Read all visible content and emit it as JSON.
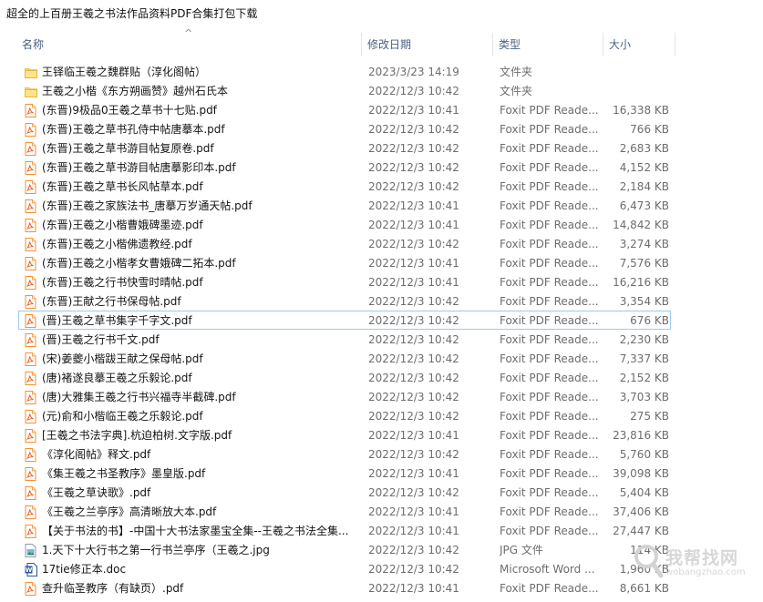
{
  "window": {
    "title": "超全的上百册王羲之书法作品资料PDF合集打包下载"
  },
  "columns": {
    "name": "名称",
    "date": "修改日期",
    "type": "类型",
    "size": "大小"
  },
  "files": [
    {
      "icon": "folder",
      "name": "王铎临王羲之魏群贴（淳化阁帖）",
      "date": "2023/3/23 14:19",
      "type": "文件夹",
      "size": ""
    },
    {
      "icon": "folder",
      "name": "王羲之小楷《东方朔画赞》越州石氏本",
      "date": "2022/12/3 10:42",
      "type": "文件夹",
      "size": ""
    },
    {
      "icon": "pdf",
      "name": "(东晋)9极品0王羲之草书十七贴.pdf",
      "date": "2022/12/3 10:41",
      "type": "Foxit PDF Reade...",
      "size": "16,338 KB"
    },
    {
      "icon": "pdf",
      "name": "(东晋)王羲之草书孔侍中帖唐摹本.pdf",
      "date": "2022/12/3 10:42",
      "type": "Foxit PDF Reade...",
      "size": "766 KB"
    },
    {
      "icon": "pdf",
      "name": "(东晋)王羲之草书游目帖复原卷.pdf",
      "date": "2022/12/3 10:42",
      "type": "Foxit PDF Reade...",
      "size": "2,683 KB"
    },
    {
      "icon": "pdf",
      "name": "(东晋)王羲之草书游目帖唐摹影印本.pdf",
      "date": "2022/12/3 10:42",
      "type": "Foxit PDF Reade...",
      "size": "4,152 KB"
    },
    {
      "icon": "pdf",
      "name": "(东晋)王羲之草书长风帖草本.pdf",
      "date": "2022/12/3 10:42",
      "type": "Foxit PDF Reade...",
      "size": "2,184 KB"
    },
    {
      "icon": "pdf",
      "name": "(东晋)王羲之家族法书_唐摹万岁通天帖.pdf",
      "date": "2022/12/3 10:41",
      "type": "Foxit PDF Reade...",
      "size": "6,473 KB"
    },
    {
      "icon": "pdf",
      "name": "(东晋)王羲之小楷曹娥碑墨迹.pdf",
      "date": "2022/12/3 10:41",
      "type": "Foxit PDF Reade...",
      "size": "14,842 KB"
    },
    {
      "icon": "pdf",
      "name": "(东晋)王羲之小楷佛遗教经.pdf",
      "date": "2022/12/3 10:42",
      "type": "Foxit PDF Reade...",
      "size": "3,274 KB"
    },
    {
      "icon": "pdf",
      "name": "(东晋)王羲之小楷孝女曹娥碑二拓本.pdf",
      "date": "2022/12/3 10:41",
      "type": "Foxit PDF Reade...",
      "size": "7,576 KB"
    },
    {
      "icon": "pdf",
      "name": "(东晋)王羲之行书快雪时晴帖.pdf",
      "date": "2022/12/3 10:41",
      "type": "Foxit PDF Reade...",
      "size": "16,216 KB"
    },
    {
      "icon": "pdf",
      "name": "(东晋)王献之行书保母帖.pdf",
      "date": "2022/12/3 10:42",
      "type": "Foxit PDF Reade...",
      "size": "3,354 KB"
    },
    {
      "icon": "pdf",
      "name": "(晋)王羲之草书集字千字文.pdf",
      "date": "2022/12/3 10:42",
      "type": "Foxit PDF Reade...",
      "size": "676 KB",
      "selected": true
    },
    {
      "icon": "pdf",
      "name": "(晋)王羲之行书千文.pdf",
      "date": "2022/12/3 10:42",
      "type": "Foxit PDF Reade...",
      "size": "2,230 KB"
    },
    {
      "icon": "pdf",
      "name": "(宋)姜夔小楷跋王献之保母帖.pdf",
      "date": "2022/12/3 10:42",
      "type": "Foxit PDF Reade...",
      "size": "7,337 KB"
    },
    {
      "icon": "pdf",
      "name": "(唐)褚遂良摹王羲之乐毅论.pdf",
      "date": "2022/12/3 10:42",
      "type": "Foxit PDF Reade...",
      "size": "2,152 KB"
    },
    {
      "icon": "pdf",
      "name": "(唐)大雅集王羲之行书兴福寺半截碑.pdf",
      "date": "2022/12/3 10:42",
      "type": "Foxit PDF Reade...",
      "size": "3,703 KB"
    },
    {
      "icon": "pdf",
      "name": "(元)俞和小楷临王羲之乐毅论.pdf",
      "date": "2022/12/3 10:42",
      "type": "Foxit PDF Reade...",
      "size": "275 KB"
    },
    {
      "icon": "pdf",
      "name": "[王羲之书法字典].杭迫柏树.文字版.pdf",
      "date": "2022/12/3 10:41",
      "type": "Foxit PDF Reade...",
      "size": "23,816 KB"
    },
    {
      "icon": "pdf",
      "name": "《淳化阁帖》释文.pdf",
      "date": "2022/12/3 10:42",
      "type": "Foxit PDF Reade...",
      "size": "5,760 KB"
    },
    {
      "icon": "pdf",
      "name": "《集王羲之书圣教序》墨皇版.pdf",
      "date": "2022/12/3 10:41",
      "type": "Foxit PDF Reade...",
      "size": "39,098 KB"
    },
    {
      "icon": "pdf",
      "name": "《王羲之草诀歌》.pdf",
      "date": "2022/12/3 10:42",
      "type": "Foxit PDF Reade...",
      "size": "5,404 KB"
    },
    {
      "icon": "pdf",
      "name": "《王羲之兰亭序》高清晰放大本.pdf",
      "date": "2022/12/3 10:41",
      "type": "Foxit PDF Reade...",
      "size": "37,406 KB"
    },
    {
      "icon": "pdf",
      "name": "【关于书法的书】-中国十大书法家墨宝全集--王羲之书法全集...",
      "date": "2022/12/3 10:41",
      "type": "Foxit PDF Reade...",
      "size": "27,447 KB"
    },
    {
      "icon": "jpg",
      "name": "1.天下十大行书之第一行书兰亭序（王羲之.jpg",
      "date": "2022/12/3 10:42",
      "type": "JPG 文件",
      "size": "114 KB"
    },
    {
      "icon": "doc",
      "name": "17tie修正本.doc",
      "date": "2022/12/3 10:42",
      "type": "Microsoft Word ...",
      "size": "1,960 KB"
    },
    {
      "icon": "pdf",
      "name": "查升临圣教序（有缺页）.pdf",
      "date": "2022/12/3 10:41",
      "type": "Foxit PDF Reade...",
      "size": "8,661 KB"
    }
  ],
  "watermark": {
    "text": "我帮找网",
    "sub": "wobangzhao.com"
  }
}
